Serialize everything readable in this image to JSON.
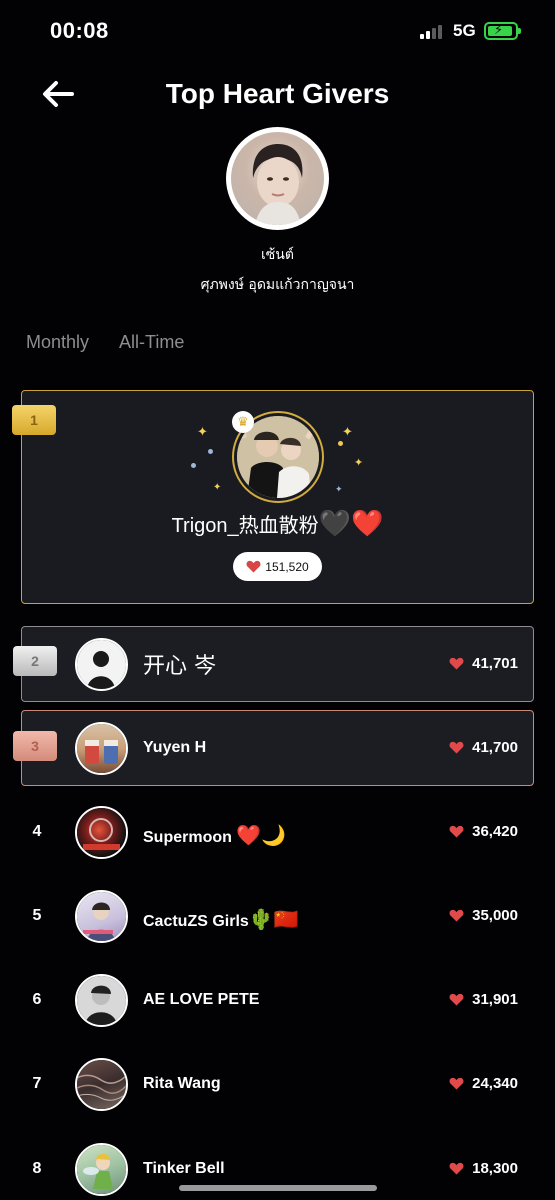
{
  "status_bar": {
    "time": "00:08",
    "network": "5G"
  },
  "header": {
    "title": "Top Heart Givers"
  },
  "creator": {
    "name": "เซ้นต์",
    "full_name": "ศุภพงษ์ อุดมแก้วกาญจนา"
  },
  "tabs": [
    {
      "label": "Monthly"
    },
    {
      "label": "All-Time"
    }
  ],
  "leaderboard": [
    {
      "rank": "1",
      "name": "Trigon_热血散粉",
      "name_emoji": "🖤❤️",
      "hearts": "151,520"
    },
    {
      "rank": "2",
      "name": "开心 岑",
      "name_emoji": "",
      "hearts": "41,701"
    },
    {
      "rank": "3",
      "name": "Yuyen H",
      "name_emoji": "",
      "hearts": "41,700"
    },
    {
      "rank": "4",
      "name": "Supermoon",
      "name_emoji": "❤️🌙",
      "hearts": "36,420"
    },
    {
      "rank": "5",
      "name": "CactuZS Girls",
      "name_emoji": "🌵🇨🇳",
      "hearts": "35,000"
    },
    {
      "rank": "6",
      "name": "AE LOVE PETE",
      "name_emoji": "",
      "hearts": "31,901"
    },
    {
      "rank": "7",
      "name": "Rita Wang",
      "name_emoji": "",
      "hearts": "24,340"
    },
    {
      "rank": "8",
      "name": "Tinker  Bell",
      "name_emoji": "",
      "hearts": "18,300"
    }
  ],
  "colors": {
    "gold": "#c9a23a",
    "silver": "#8d8d92",
    "bronze": "#c98b78",
    "heart": "#e04a4a",
    "battery": "#37d349"
  }
}
